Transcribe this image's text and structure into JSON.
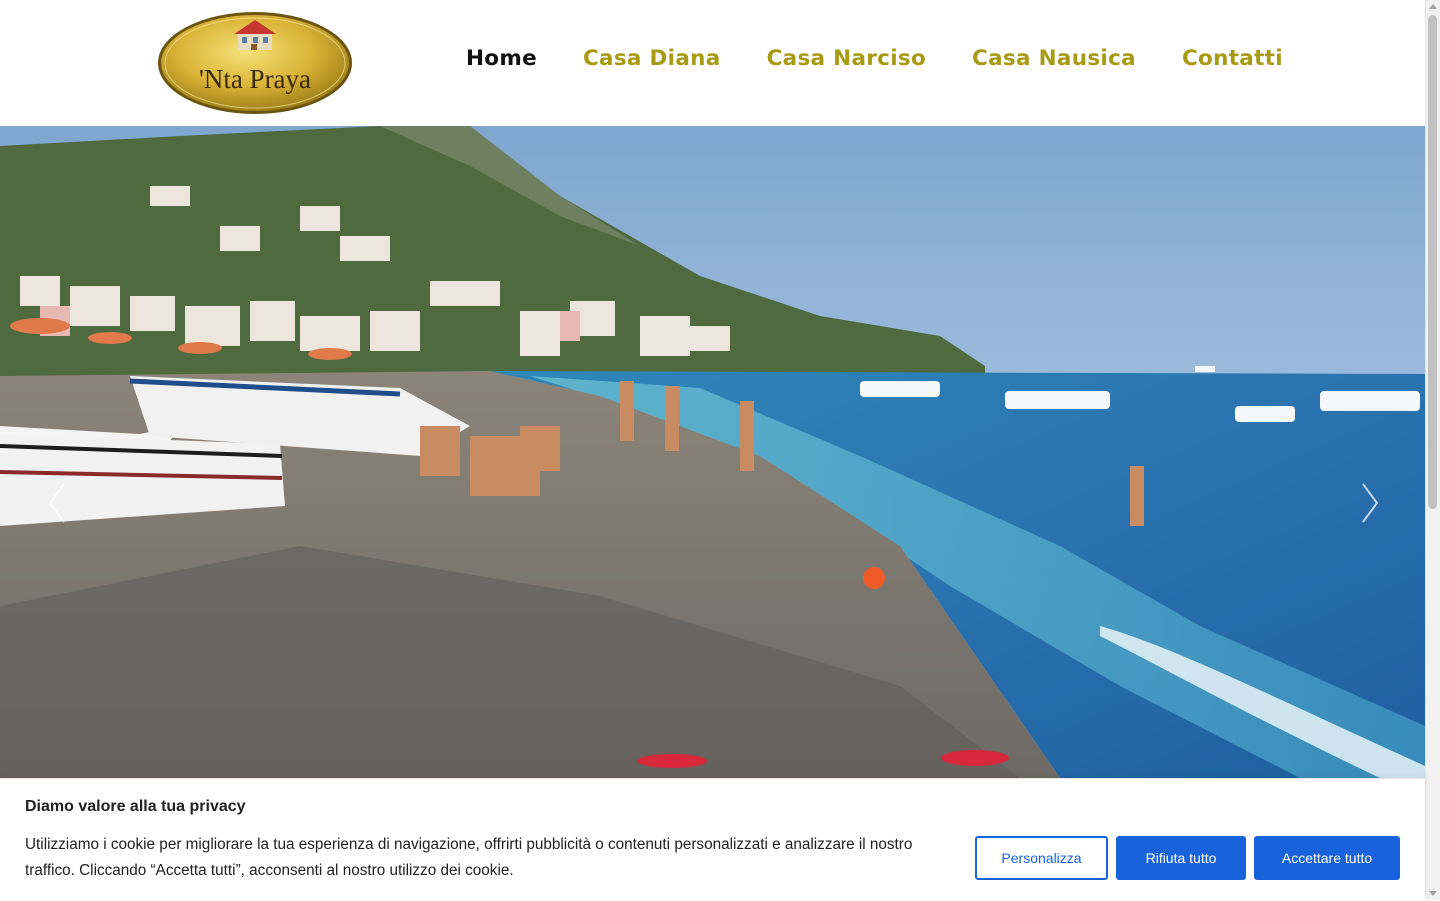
{
  "logo": {
    "text": "'Nta Praya",
    "icon": "house-icon"
  },
  "nav": {
    "items": [
      {
        "label": "Home",
        "active": true
      },
      {
        "label": "Casa Diana",
        "active": false
      },
      {
        "label": "Casa Narciso",
        "active": false
      },
      {
        "label": "Casa Nausica",
        "active": false
      },
      {
        "label": "Contatti",
        "active": false
      }
    ]
  },
  "hero": {
    "prev_icon": "chevron-left-icon",
    "next_icon": "chevron-right-icon"
  },
  "cookie": {
    "title": "Diamo valore alla tua privacy",
    "text": "Utilizziamo i cookie per migliorare la tua esperienza di navigazione, offrirti pubblicità o contenuti personalizzati e analizzare il nostro traffico. Cliccando “Accetta tutti”, acconsenti al nostro utilizzo dei cookie.",
    "customize_label": "Personalizza",
    "reject_label": "Rifiuta tutto",
    "accept_label": "Accettare tutto"
  },
  "colors": {
    "nav_accent": "#a79b14",
    "nav_active": "#111111",
    "cookie_button": "#1863dc"
  }
}
